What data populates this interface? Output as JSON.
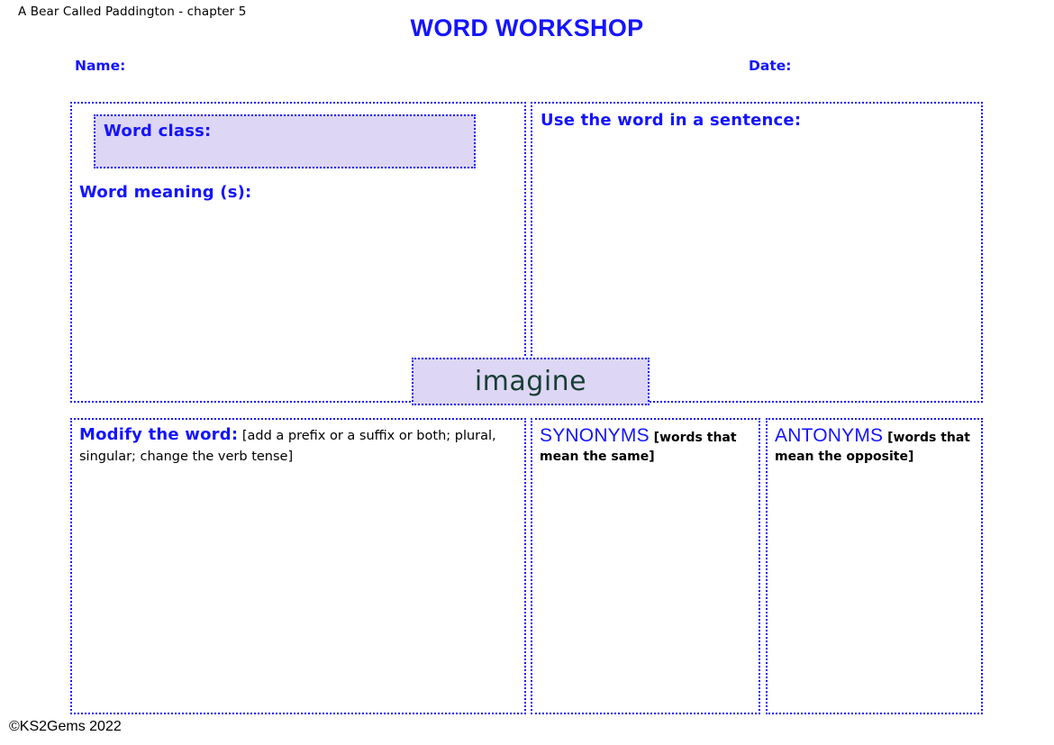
{
  "header": {
    "book_reference": "A Bear Called Paddington - chapter 5",
    "title": "WORD WORKSHOP",
    "name_label": "Name:",
    "date_label": "Date:"
  },
  "focus_word": {
    "word": "imagine",
    "text_color": "#173f35",
    "fill_color": "#ddd6f4"
  },
  "panels": {
    "word_class": {
      "label": "Word class:",
      "value": "",
      "fill_color": "#ddd6f4"
    },
    "word_meaning": {
      "label": "Word meaning (s):",
      "value": ""
    },
    "sentence": {
      "label": "Use the word in a sentence:",
      "value": ""
    },
    "modify": {
      "label": "Modify the word:",
      "hint": "[add a prefix or a suffix or both; plural, singular; change the verb tense]",
      "value": ""
    },
    "synonyms": {
      "label": "SYNONYMS",
      "hint": "[words that mean the same]",
      "value": ""
    },
    "antonyms": {
      "label": "ANTONYMS",
      "hint": "[words that mean the opposite]",
      "value": ""
    }
  },
  "footer": {
    "copyright": "©KS2Gems 2022"
  },
  "theme": {
    "accent_blue": "#1414ff",
    "panel_fill": "#ddd6f4",
    "page_background": "#ffffff"
  }
}
